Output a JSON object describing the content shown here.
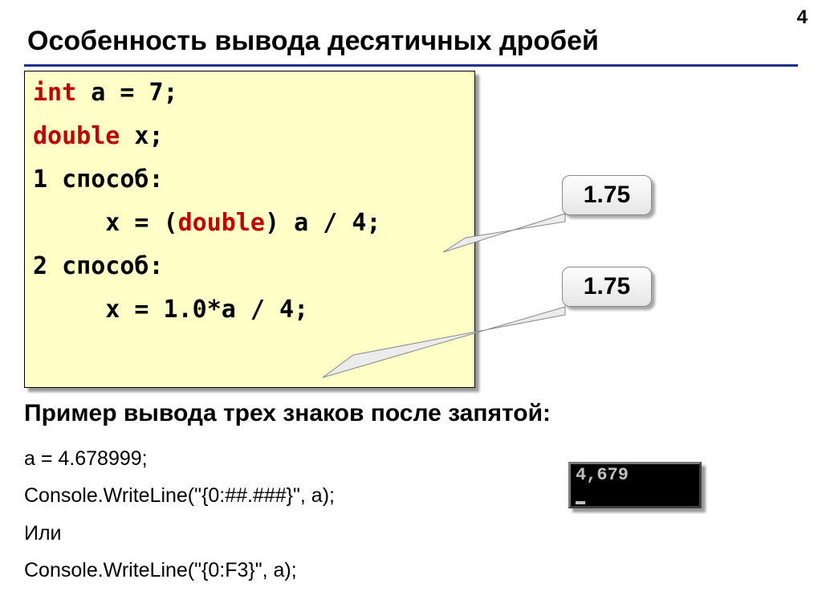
{
  "page_number": "4",
  "title": "Особенность вывода десятичных дробей",
  "code": {
    "line1_kw": "int",
    "line1_rest": " a = 7;",
    "line2_kw": "double",
    "line2_rest": " x;",
    "line3": "1 способ:",
    "line4_pre": "     x = (",
    "line4_kw": "double",
    "line4_post": ") a / 4;",
    "line5": "2 способ:",
    "line6": "     x = 1.0*a / 4;"
  },
  "callout1": "1.75",
  "callout2": "1.75",
  "subheading": "Пример вывода трех знаков после запятой:",
  "example": {
    "l1": "a = 4.678999;",
    "l2": "Console.WriteLine(\"{0:##.###}\", a);",
    "l3": "Или",
    "l4": "Console.WriteLine(\"{0:F3}\", a);"
  },
  "console_output": "4,679"
}
